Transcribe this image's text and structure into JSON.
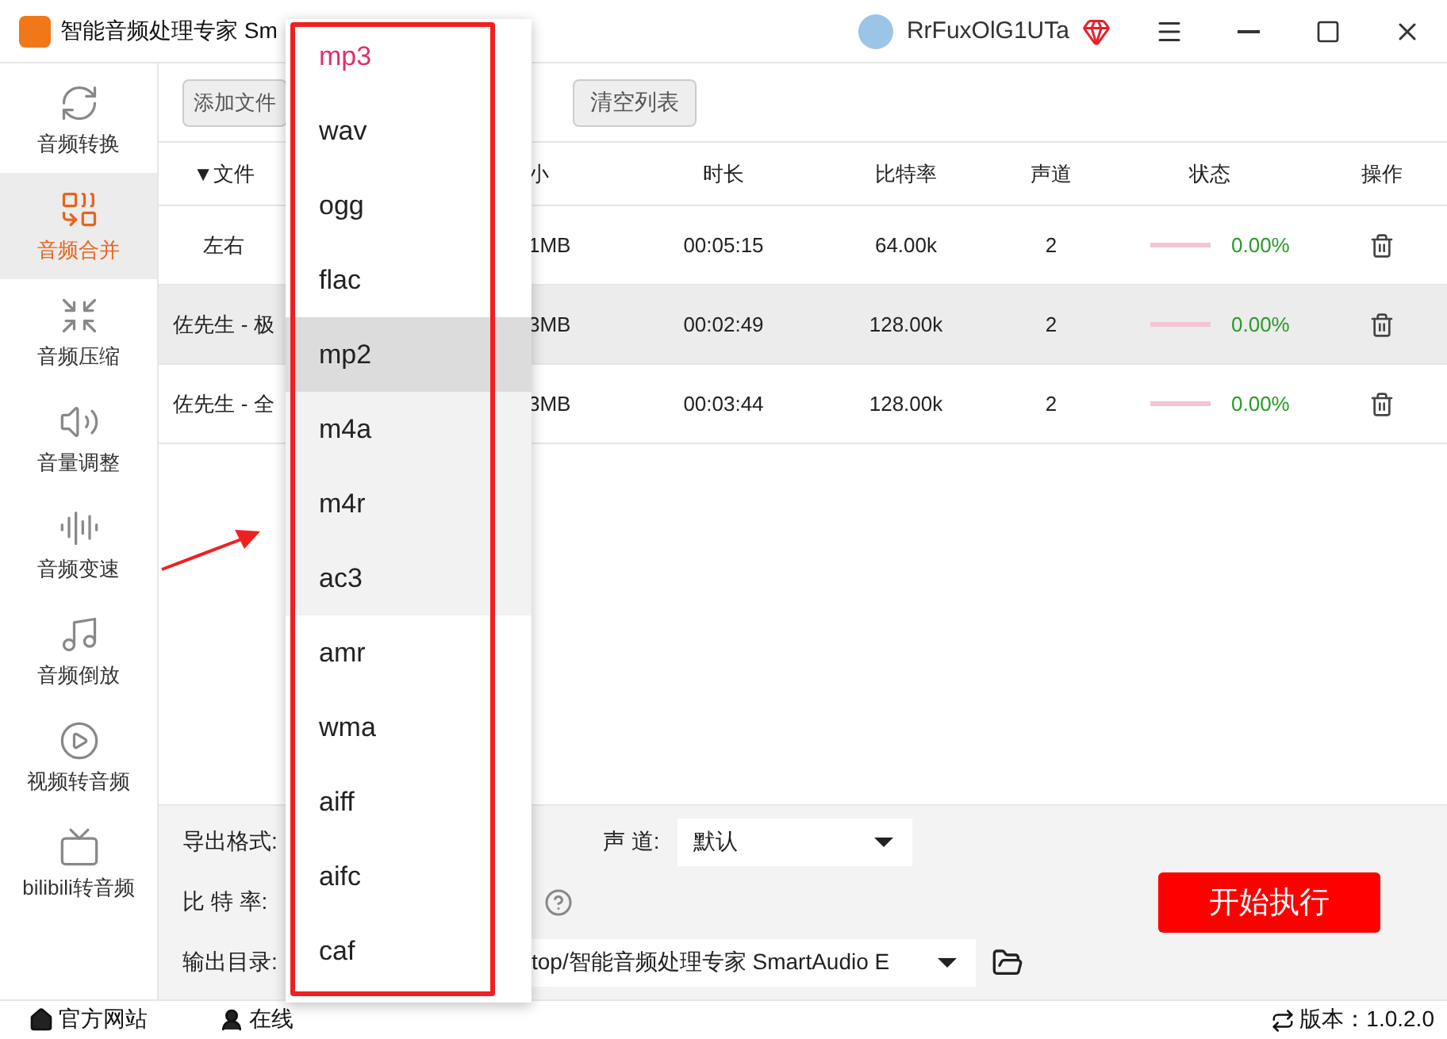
{
  "window": {
    "title": "智能音频处理专家 Sm",
    "user": "RrFuxOlG1UTa"
  },
  "sidebar": {
    "items": [
      {
        "label": "音频转换",
        "selected": false
      },
      {
        "label": "音频合并",
        "selected": true
      },
      {
        "label": "音频压缩",
        "selected": false
      },
      {
        "label": "音量调整",
        "selected": false
      },
      {
        "label": "音频变速",
        "selected": false
      },
      {
        "label": "音频倒放",
        "selected": false
      },
      {
        "label": "视频转音频",
        "selected": false
      },
      {
        "label": "bilibili转音频",
        "selected": false
      }
    ]
  },
  "toolbar": {
    "buttons": [
      "添加文件",
      "清空列表"
    ]
  },
  "table": {
    "columns": [
      "▼文件",
      "小",
      "时长",
      "比特率",
      "声道",
      "状态",
      "操作"
    ],
    "rows": [
      {
        "name": "左右",
        "size": "1MB",
        "duration": "00:05:15",
        "bitrate": "64.00k",
        "channels": "2",
        "level": 0,
        "status": "0.00%",
        "selected": false
      },
      {
        "name": "佐先生 - 极",
        "size": "3MB",
        "duration": "00:02:49",
        "bitrate": "128.00k",
        "channels": "2",
        "level": 0,
        "status": "0.00%",
        "selected": true
      },
      {
        "name": "佐先生 - 全",
        "size": "3MB",
        "duration": "00:03:44",
        "bitrate": "128.00k",
        "channels": "2",
        "level": 0,
        "status": "0.00%",
        "selected": false
      }
    ]
  },
  "settings": {
    "format_label": "导出格式:",
    "bitrate_label": "比 特 率:",
    "output_label": "输出目录:",
    "output_path": "top/智能音频处理专家 SmartAudio E",
    "channel_label": "声 道:",
    "channel_value": "默认",
    "start_button": "开始执行"
  },
  "format_dropdown": {
    "options": [
      {
        "label": "mp3",
        "selected": true,
        "hovered": false,
        "highlighted": false
      },
      {
        "label": "wav",
        "selected": false,
        "hovered": false,
        "highlighted": false
      },
      {
        "label": "ogg",
        "selected": false,
        "hovered": false,
        "highlighted": false
      },
      {
        "label": "flac",
        "selected": false,
        "hovered": false,
        "highlighted": false
      },
      {
        "label": "mp2",
        "selected": false,
        "hovered": true,
        "highlighted": false
      },
      {
        "label": "m4a",
        "selected": false,
        "hovered": false,
        "highlighted": true
      },
      {
        "label": "m4r",
        "selected": false,
        "hovered": false,
        "highlighted": true
      },
      {
        "label": "ac3",
        "selected": false,
        "hovered": false,
        "highlighted": true
      },
      {
        "label": "amr",
        "selected": false,
        "hovered": false,
        "highlighted": false
      },
      {
        "label": "wma",
        "selected": false,
        "hovered": false,
        "highlighted": false
      },
      {
        "label": "aiff",
        "selected": false,
        "hovered": false,
        "highlighted": false
      },
      {
        "label": "aifc",
        "selected": false,
        "hovered": false,
        "highlighted": false
      },
      {
        "label": "caf",
        "selected": false,
        "hovered": false,
        "highlighted": false
      }
    ]
  },
  "footer": {
    "links": [
      "官方网站",
      "在线"
    ],
    "version": "版本：1.0.2.0"
  }
}
